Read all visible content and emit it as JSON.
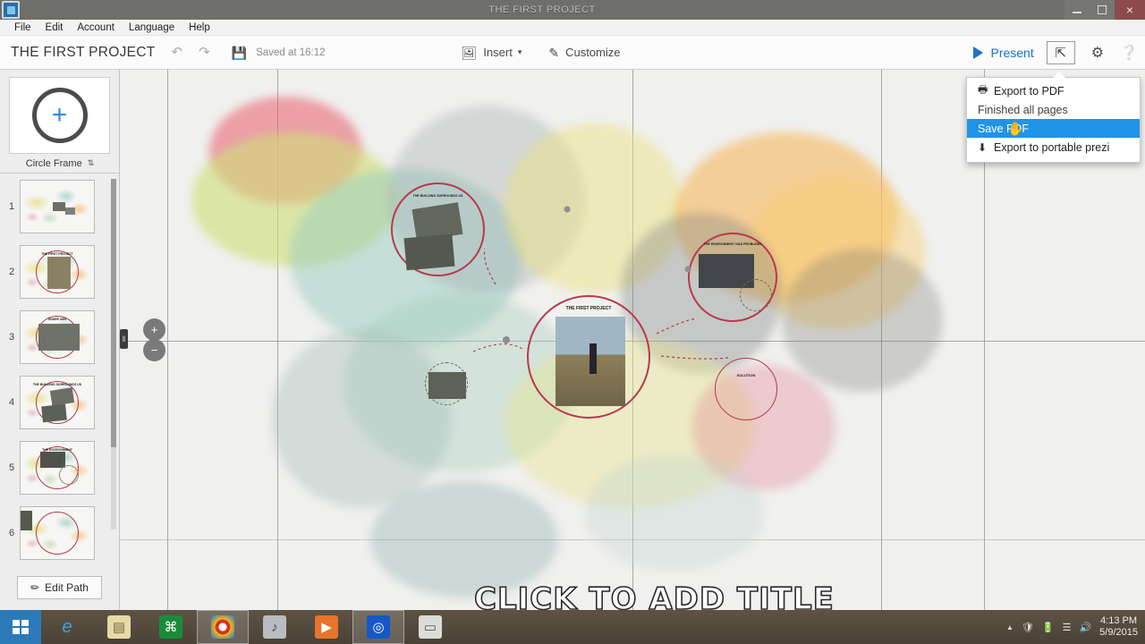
{
  "window": {
    "title": "THE FIRST PROJECT",
    "app_icon": "prezi-app-icon",
    "controls": {
      "minimize": "minimize-icon",
      "maximize": "maximize-icon",
      "close": "×"
    }
  },
  "menubar": {
    "items": [
      "File",
      "Edit",
      "Account",
      "Language",
      "Help"
    ]
  },
  "toolbar": {
    "doc_title": "THE FIRST PROJECT",
    "undo": "undo-icon",
    "redo": "redo-icon",
    "save": "save-icon",
    "saved_text": "Saved at 16:12",
    "insert_label": "Insert",
    "insert_caret": "▾",
    "customize_label": "Customize",
    "present_label": "Present",
    "share_icon": "share-icon",
    "settings_icon": "gear-icon",
    "help_icon": "help-icon"
  },
  "share_menu": {
    "items": [
      {
        "label": "Export to PDF",
        "icon": "printer-icon",
        "state": "normal"
      },
      {
        "label": "Finished all pages",
        "icon": "",
        "state": "plain"
      },
      {
        "label": "Save PDF",
        "icon": "",
        "state": "selected"
      },
      {
        "label": "Export to portable prezi",
        "icon": "download-icon",
        "state": "normal"
      }
    ],
    "cursor": "✉",
    "highlight_color": "#2094e8"
  },
  "sidebar": {
    "frame_tool": {
      "icon": "circle-frame-plus-icon",
      "plus": "+"
    },
    "frame_label": "Circle Frame",
    "frame_label_spinner": "⇅",
    "thumbnails": [
      {
        "number": "1",
        "title": ""
      },
      {
        "number": "2",
        "title": "THE FIRST PROJECT"
      },
      {
        "number": "3",
        "title": "SHARE ABS"
      },
      {
        "number": "4",
        "title": "THE BUILDING SURROUNDS US"
      },
      {
        "number": "5",
        "title": "THE ENVIRONMENT"
      },
      {
        "number": "6",
        "title": ""
      }
    ],
    "edit_path_label": "Edit Path",
    "edit_path_icon": "pencil-icon"
  },
  "canvas": {
    "zoom_in": "+",
    "zoom_out": "−",
    "zoom_handle": "zoom-slider-handle",
    "big_title": "CLICK TO ADD TITLE",
    "frames": [
      {
        "name": "frame-building",
        "title": "THE BUILDING SURROUNDS US"
      },
      {
        "name": "frame-main",
        "title": "THE FIRST PROJECT"
      },
      {
        "name": "frame-environment",
        "title": "THE ENVIRONMENT HAS PROBLEMS"
      },
      {
        "name": "frame-small-right",
        "title": "SOLUTION"
      },
      {
        "name": "frame-small-bottom",
        "title": ""
      }
    ],
    "frame_color": "#b8394d"
  },
  "taskbar": {
    "start": "windows-start-icon",
    "items": [
      {
        "name": "internet-explorer-icon",
        "glyph": "e"
      },
      {
        "name": "file-explorer-icon",
        "glyph": "▤"
      },
      {
        "name": "store-icon",
        "glyph": "⌘"
      },
      {
        "name": "chrome-icon",
        "glyph": "◉"
      },
      {
        "name": "media-player-icon",
        "glyph": "♪"
      },
      {
        "name": "video-player-icon",
        "glyph": "▶"
      },
      {
        "name": "prezi-icon",
        "glyph": "◎"
      },
      {
        "name": "projector-icon",
        "glyph": "▭"
      }
    ],
    "tray": {
      "arrow": "▲",
      "security": "security-icon",
      "battery": "battery-icon",
      "network": "network-icon",
      "volume": "volume-icon"
    },
    "clock_time": "4:13 PM",
    "clock_date": "5/9/2015"
  }
}
